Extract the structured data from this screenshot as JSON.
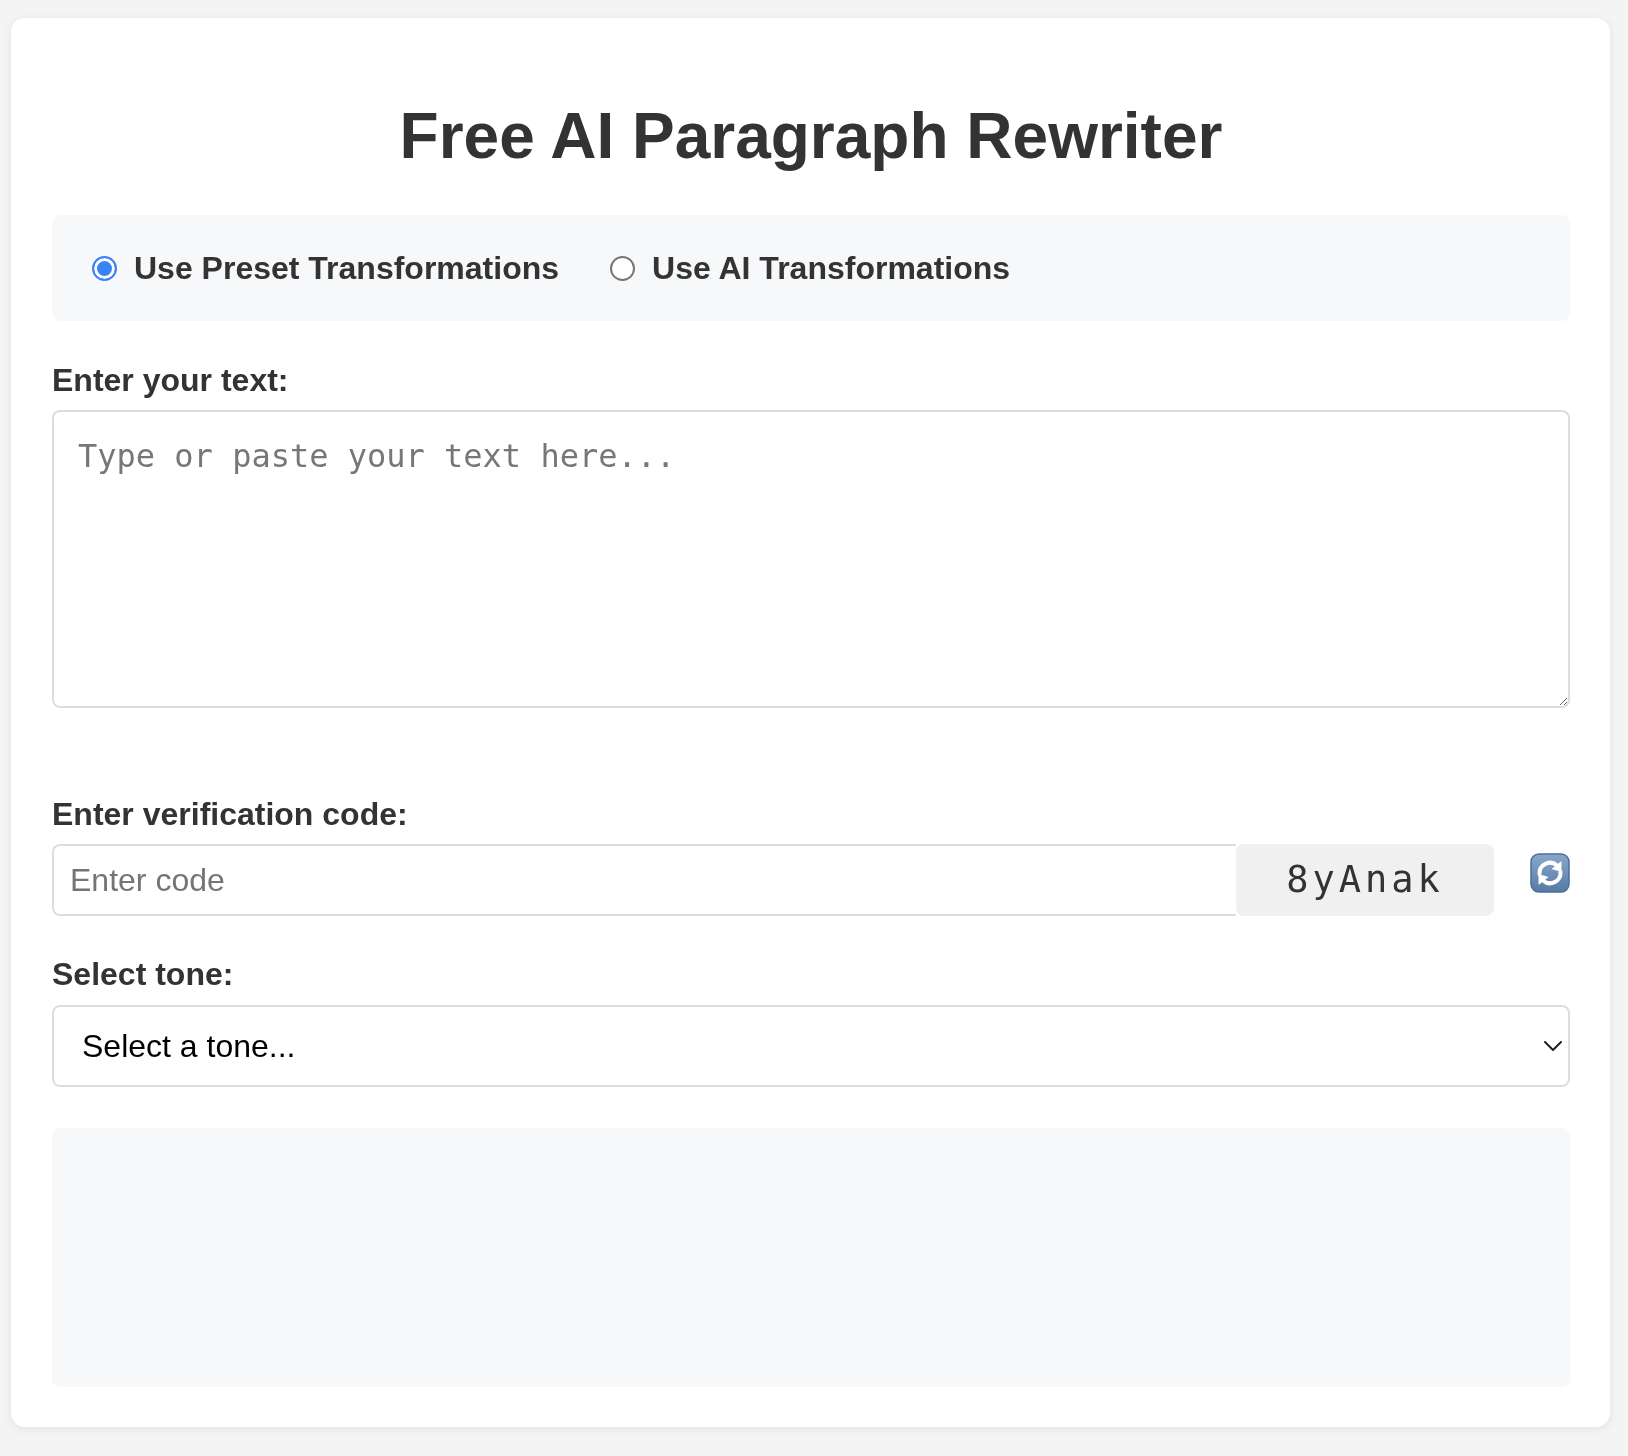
{
  "title": "Free AI Paragraph Rewriter",
  "modes": [
    {
      "label": "Use Preset Transformations",
      "selected": true
    },
    {
      "label": "Use AI Transformations",
      "selected": false
    }
  ],
  "text_input": {
    "label": "Enter your text:",
    "placeholder": "Type or paste your text here..."
  },
  "verification": {
    "label": "Enter verification code:",
    "placeholder": "Enter code",
    "code": "8yAnak"
  },
  "tone": {
    "label": "Select tone:",
    "value": "Select a tone..."
  }
}
